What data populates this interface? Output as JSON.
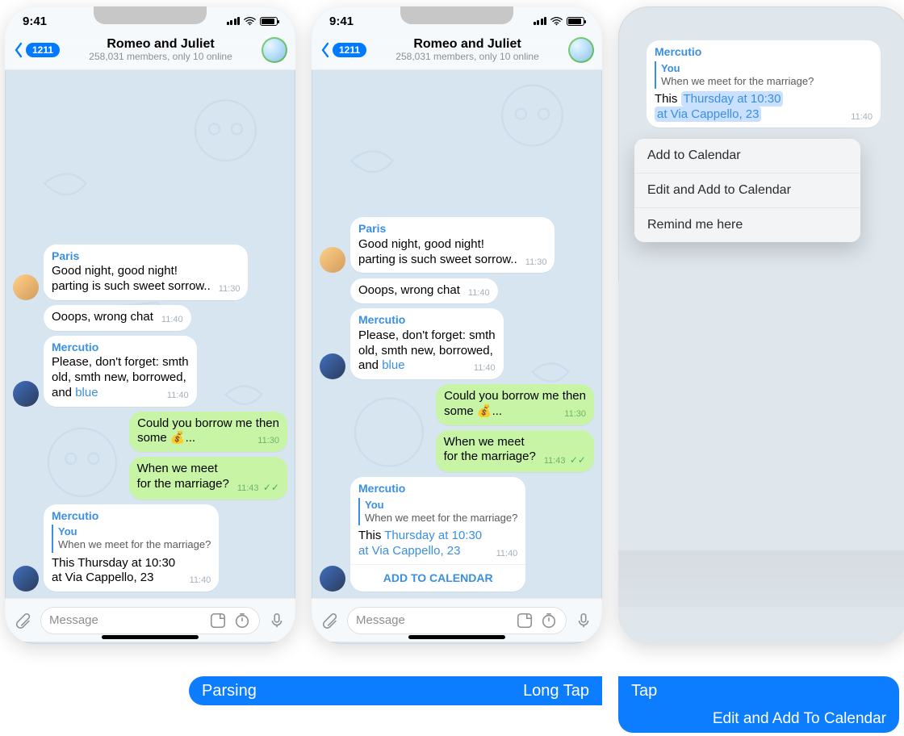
{
  "status": {
    "time": "9:41"
  },
  "header": {
    "back_count": "1211",
    "title": "Romeo and Juliet",
    "subtitle": "258,031 members, only 10 online"
  },
  "msg": {
    "paris": {
      "name": "Paris",
      "line1": "Good night, good night!",
      "line2": "parting is such sweet sorrow..",
      "time": "11:30"
    },
    "oops": {
      "text": "Ooops, wrong chat",
      "time": "11:40"
    },
    "mercutio1": {
      "name": "Mercutio",
      "l1": "Please, don't forget: smth",
      "l2": "old, smth new, borrowed,",
      "l3_pre": "and ",
      "l3_link": "blue",
      "time": "11:40"
    },
    "out1": {
      "l1": "Could you borrow me then",
      "l2": "some 💰...",
      "time": "11:30"
    },
    "out2": {
      "l1": "When we meet",
      "l2": "for the marriage?",
      "time": "11:43"
    },
    "mercutio2": {
      "name": "Mercutio",
      "reply_who": "You",
      "reply_what": "When we meet for the marriage?",
      "body_pre": "This ",
      "body_a": "Thursday at 10:30",
      "body_b": "at Via Cappello, 23",
      "time": "11:40",
      "inline_btn": "ADD TO CALENDAR"
    },
    "plain_l1": "This Thursday at 10:30",
    "plain_l2": "at Via Cappello, 23"
  },
  "input": {
    "placeholder": "Message"
  },
  "ctx_menu": {
    "i1": "Add to Calendar",
    "i2": "Edit and Add to Calendar",
    "i3": "Remind me here"
  },
  "banner": {
    "parsing": "Parsing",
    "longtap": "Long Tap",
    "tap": "Tap",
    "edit": "Edit and Add To Calendar"
  }
}
